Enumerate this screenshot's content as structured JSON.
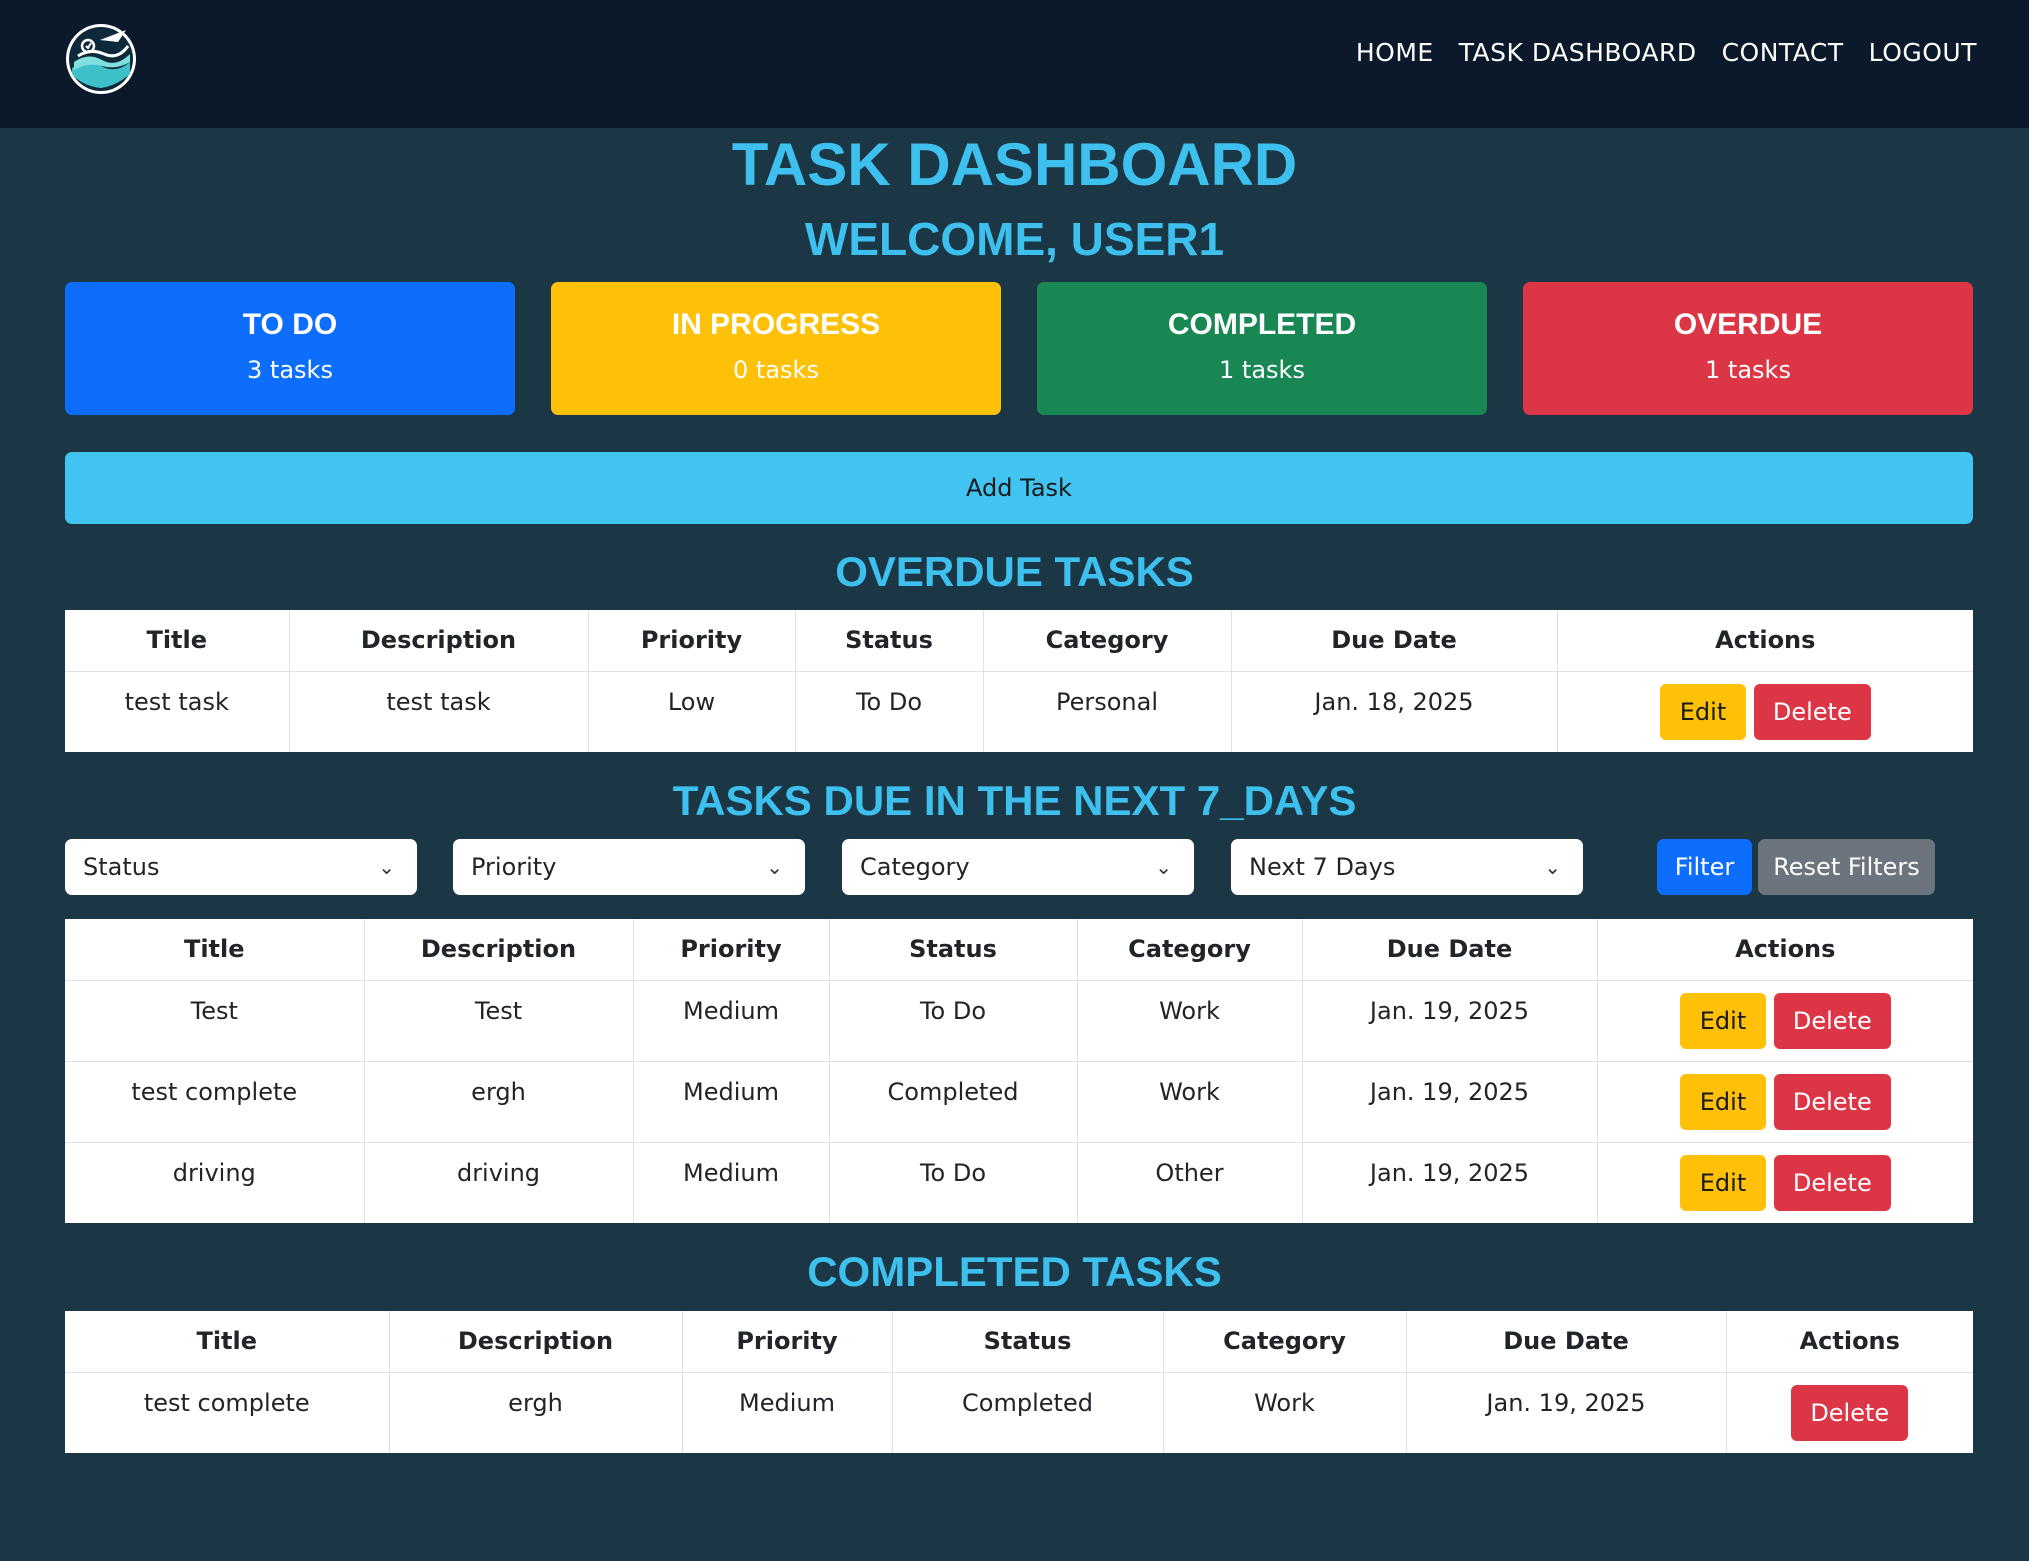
{
  "nav": {
    "links": [
      "HOME",
      "TASK DASHBOARD",
      "CONTACT",
      "LOGOUT"
    ]
  },
  "header": {
    "title": "TASK DASHBOARD",
    "welcome": "WELCOME, USER1"
  },
  "stats": [
    {
      "label": "TO DO",
      "count": "3 tasks",
      "color": "#0d6efd"
    },
    {
      "label": "IN PROGRESS",
      "count": "0 tasks",
      "color": "#ffc107"
    },
    {
      "label": "COMPLETED",
      "count": "1 tasks",
      "color": "#198754"
    },
    {
      "label": "OVERDUE",
      "count": "1 tasks",
      "color": "#dc3545"
    }
  ],
  "add_task_label": "Add Task",
  "columns": [
    "Title",
    "Description",
    "Priority",
    "Status",
    "Category",
    "Due Date",
    "Actions"
  ],
  "buttons": {
    "edit": "Edit",
    "delete": "Delete"
  },
  "overdue": {
    "title": "OVERDUE TASKS",
    "rows": [
      [
        "test task",
        "test task",
        "Low",
        "To Do",
        "Personal",
        "Jan. 18, 2025"
      ]
    ]
  },
  "upcoming": {
    "title": "TASKS DUE IN THE NEXT 7_DAYS",
    "filters": {
      "status": "Status",
      "priority": "Priority",
      "category": "Category",
      "range": "Next 7 Days",
      "filter_button": "Filter",
      "reset_button": "Reset Filters"
    },
    "rows": [
      [
        "Test",
        "Test",
        "Medium",
        "To Do",
        "Work",
        "Jan. 19, 2025"
      ],
      [
        "test complete",
        "ergh",
        "Medium",
        "Completed",
        "Work",
        "Jan. 19, 2025"
      ],
      [
        "driving",
        "driving",
        "Medium",
        "To Do",
        "Other",
        "Jan. 19, 2025"
      ]
    ]
  },
  "completed": {
    "title": "COMPLETED TASKS",
    "rows": [
      [
        "test complete",
        "ergh",
        "Medium",
        "Completed",
        "Work",
        "Jan. 19, 2025"
      ]
    ]
  }
}
